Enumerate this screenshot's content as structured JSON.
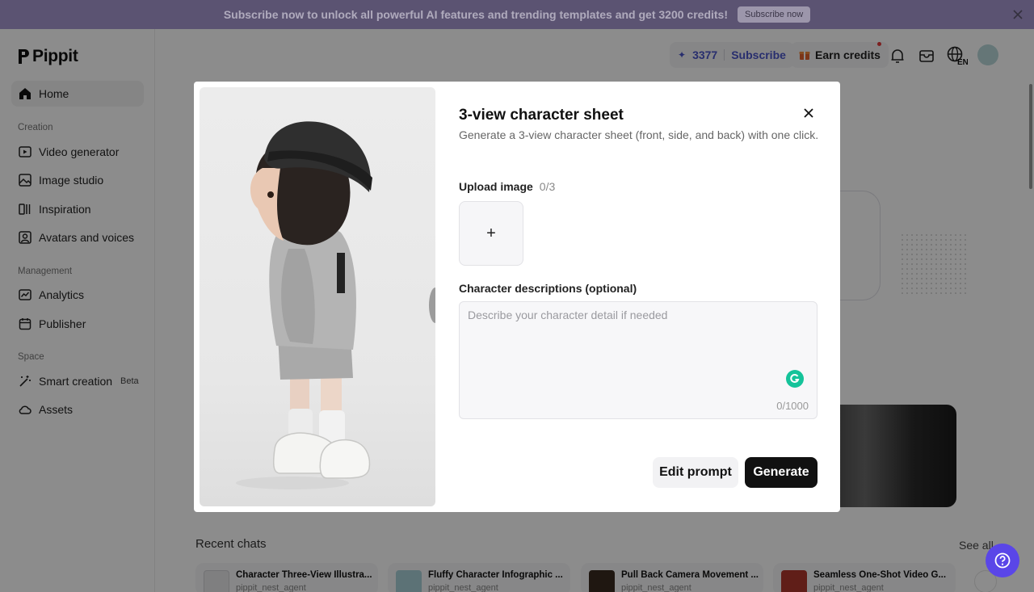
{
  "banner": {
    "text": "Subscribe now to unlock all powerful AI features and trending templates and get 3200 credits!",
    "button_label": "Subscribe now"
  },
  "app": {
    "name": "Pippit"
  },
  "sidebar": {
    "home_label": "Home",
    "sections": {
      "creation": "Creation",
      "management": "Management",
      "space": "Space"
    },
    "items": [
      {
        "label": "Video generator",
        "icon": "video-generator-icon"
      },
      {
        "label": "Image studio",
        "icon": "image-icon"
      },
      {
        "label": "Inspiration",
        "icon": "inspiration-icon"
      },
      {
        "label": "Avatars and voices",
        "icon": "avatar-icon"
      },
      {
        "label": "Analytics",
        "icon": "analytics-icon"
      },
      {
        "label": "Publisher",
        "icon": "calendar-icon"
      },
      {
        "label": "Smart creation",
        "icon": "magic-wand-icon",
        "badge": "Beta"
      },
      {
        "label": "Assets",
        "icon": "cloud-icon"
      }
    ]
  },
  "header": {
    "credits": "3377",
    "subscribe_label": "Subscribe",
    "earn_label": "Earn credits",
    "language": "EN"
  },
  "modal": {
    "title": "3-view character sheet",
    "subtitle": "Generate a 3-view character sheet (front, side, and back) with one click.",
    "upload_label": "Upload image",
    "upload_count": "0/3",
    "upload_plus": "+",
    "desc_label": "Character descriptions (optional)",
    "desc_placeholder": "Describe your character detail if needed",
    "desc_value": "",
    "char_count": "0/1000",
    "edit_prompt_label": "Edit prompt",
    "generate_label": "Generate"
  },
  "recent": {
    "title": "Recent chats",
    "see_all": "See all",
    "chats": [
      {
        "title": "Character Three-View Illustra...",
        "sub": "pippit_nest_agent"
      },
      {
        "title": "Fluffy Character Infographic ...",
        "sub": "pippit_nest_agent"
      },
      {
        "title": "Pull Back Camera Movement ...",
        "sub": "pippit_nest_agent"
      },
      {
        "title": "Seamless One-Shot Video G...",
        "sub": "pippit_nest_agent"
      }
    ]
  },
  "colors": {
    "banner_bg": "#5b5372",
    "accent": "#4a55c9",
    "help_button": "#5a46e8",
    "generate_bg": "#111111"
  }
}
